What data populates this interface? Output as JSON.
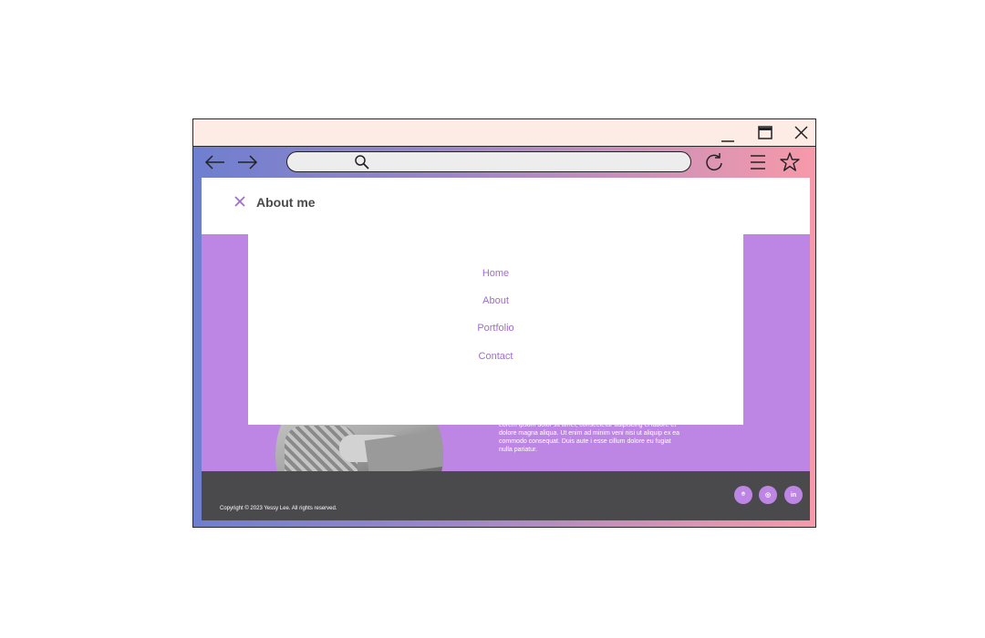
{
  "site": {
    "title": "About me"
  },
  "menu": {
    "items": [
      {
        "label": "Home"
      },
      {
        "label": "About"
      },
      {
        "label": "Portfolio"
      },
      {
        "label": "Contact"
      }
    ]
  },
  "about": {
    "paragraph": "Lorem ipsum dolor sit amet, consectetur adipiscing el labore et dolore magna aliqua. Ut enim ad minim veni nisi ut aliquip ex ea commodo consequat. Duis aute i esse cillum dolore eu fugiat nulla pariatur."
  },
  "footer": {
    "copyright": "Copyright © 2023 Yessy Lee. All rights reserved.",
    "social": [
      {
        "name": "github-icon",
        "glyph": "⌾"
      },
      {
        "name": "instagram-icon",
        "glyph": "◎"
      },
      {
        "name": "linkedin-icon",
        "glyph": "in"
      }
    ]
  },
  "colors": {
    "accent": "#be86e4",
    "menu_text": "#a06cd0",
    "footer_bg": "#4a4a4c",
    "titlebar_bg": "#fdebe6"
  }
}
